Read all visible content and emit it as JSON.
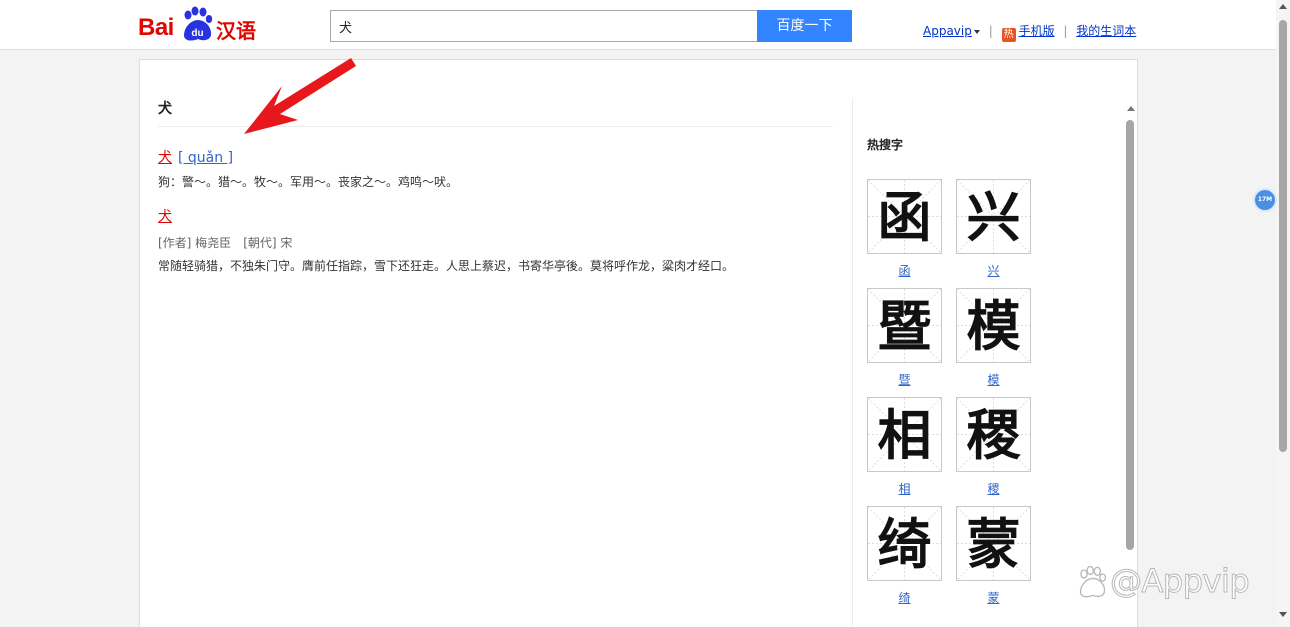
{
  "header": {
    "logo_text_latin": "Bai",
    "logo_text_paw": "du",
    "logo_text_cn": "汉语",
    "search_value": "犬",
    "search_button": "百度一下",
    "links": {
      "appavip": "Appavip",
      "hot_icon": "热",
      "mobile": "手机版",
      "wordbook": "我的生词本",
      "separator": "|"
    }
  },
  "content": {
    "word_title": "犬",
    "entry": {
      "char": "犬",
      "pinyin": "[ quǎn ]",
      "definition": "狗：警～。猎～。牧～。军用～。丧家之～。鸡鸣～吠。"
    },
    "poem": {
      "char": "犬",
      "author": "[作者] 梅尧臣",
      "dynasty": "[朝代] 宋",
      "text": "常随轻骑猎，不独朱门守。膺前任指踪，雪下还狂走。人思上蔡迟，书寄华亭後。莫将呼作龙，粱肉才经口。"
    }
  },
  "sidebar": {
    "title": "热搜字",
    "tiles": [
      {
        "char": "函",
        "label": "函"
      },
      {
        "char": "兴",
        "label": "兴"
      },
      {
        "char": "暨",
        "label": "暨"
      },
      {
        "char": "模",
        "label": "模"
      },
      {
        "char": "相",
        "label": "相"
      },
      {
        "char": "稷",
        "label": "稷"
      },
      {
        "char": "绮",
        "label": "绮"
      },
      {
        "char": "蒙",
        "label": "蒙"
      }
    ]
  },
  "badge": "17M",
  "watermark": "@Appvip",
  "colors": {
    "brand_red": "#e10601",
    "button_blue": "#3385ff",
    "link_blue": "#3066c8",
    "arrow_red": "#e8171b"
  }
}
